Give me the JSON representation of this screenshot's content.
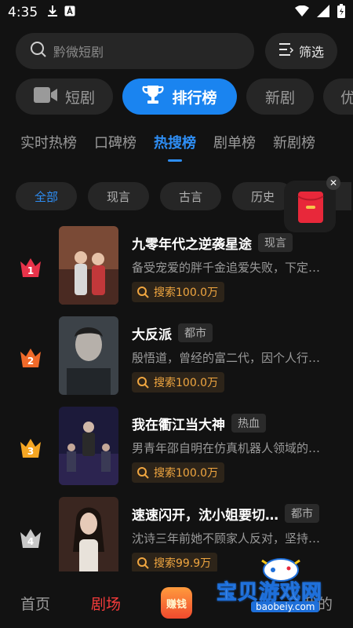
{
  "status_bar": {
    "time": "4:35"
  },
  "search": {
    "placeholder": "黔微短剧",
    "filter_label": "筛选"
  },
  "category_tabs": [
    {
      "label": "短剧",
      "icon": "video-camera-icon",
      "active": false
    },
    {
      "label": "排行榜",
      "icon": "trophy-icon",
      "active": true
    },
    {
      "label": "新剧",
      "active": false
    },
    {
      "label": "优",
      "active": false
    }
  ],
  "ranking_tabs": [
    "实时热榜",
    "口碑榜",
    "热搜榜",
    "剧单榜",
    "新剧榜"
  ],
  "active_ranking_tab": "热搜榜",
  "genres": [
    "全部",
    "现言",
    "古言",
    "历史"
  ],
  "active_genre": "全部",
  "dramas": [
    {
      "rank": "1",
      "title": "九零年代之逆袭星途",
      "tag": "现言",
      "desc": "备受宠爱的胖千金追爱失败，下定…",
      "heat": "搜索100.0万",
      "crown_color": "#e8334a",
      "poster_text": "九零年代"
    },
    {
      "rank": "2",
      "title": "大反派",
      "tag": "都市",
      "desc": "殷悟道，曾经的富二代，因个人行…",
      "heat": "搜索100.0万",
      "crown_color": "#f06a2a",
      "poster_text": "大反派"
    },
    {
      "rank": "3",
      "title": "我在衢江当大神",
      "tag": "热血",
      "desc": "男青年邵自明在仿真机器人领域的…",
      "heat": "搜索100.0万",
      "crown_color": "#f5a623",
      "poster_text": "我在衢江当大神"
    },
    {
      "rank": "4",
      "title": "速速闪开，沈小姐要切…",
      "tag": "都市",
      "desc": "沈诗三年前她不顾家人反对，坚持…",
      "heat": "搜索99.9万",
      "crown_color": "#c8c8c8",
      "poster_text": "速速闪开"
    }
  ],
  "bottom_nav": {
    "home": "首页",
    "theater": "剧场",
    "earn": "赚钱",
    "mine": "我的"
  },
  "watermark": {
    "text": "宝贝游戏网",
    "url": "baobeiy.com"
  },
  "colors": {
    "accent": "#1a84f0",
    "nav_active": "#f33b3b",
    "heat": "#f0a640"
  }
}
